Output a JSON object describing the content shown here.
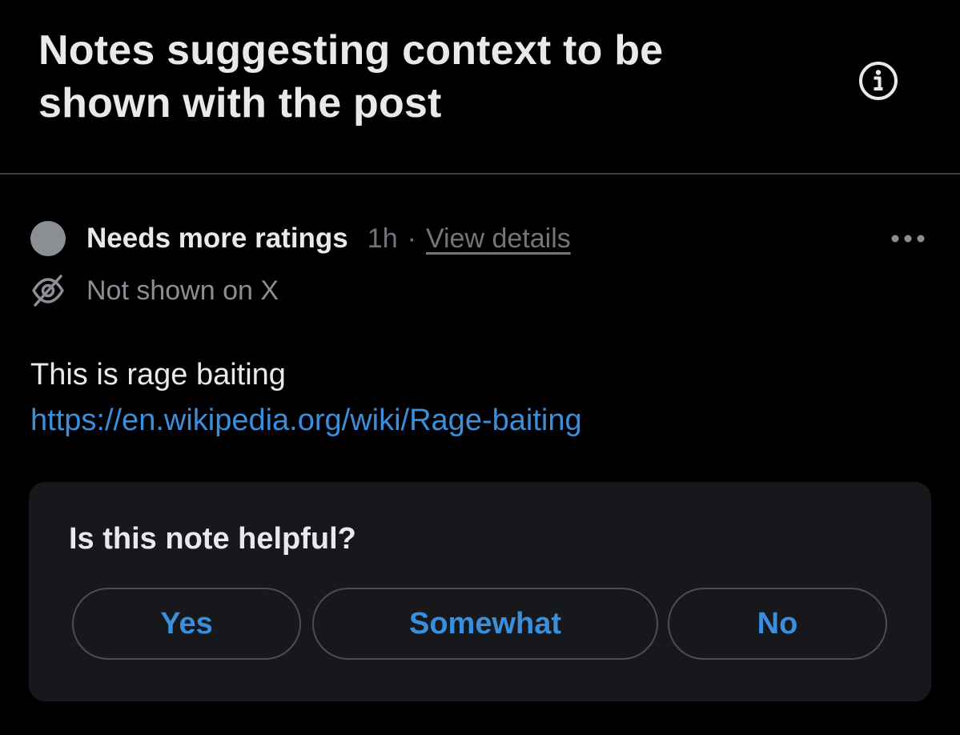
{
  "header": {
    "title": "Notes suggesting context to be shown with the post",
    "info_icon": "info-circle-icon"
  },
  "note": {
    "status": "Needs more ratings",
    "status_color": "#8b8f94",
    "time": "1h",
    "separator": "·",
    "view_details": "View details",
    "more_icon": "more-horizontal-icon",
    "visibility_icon": "eye-slash-icon",
    "visibility": "Not shown on X",
    "text": "This is rage baiting",
    "link": "https://en.wikipedia.org/wiki/Rage-baiting"
  },
  "rating": {
    "question": "Is this note helpful?",
    "options": [
      "Yes",
      "Somewhat",
      "No"
    ]
  },
  "colors": {
    "background": "#000000",
    "text": "#e7e9ea",
    "muted": "#71767b",
    "accent": "#3a8fdd",
    "card": "#16181c"
  }
}
